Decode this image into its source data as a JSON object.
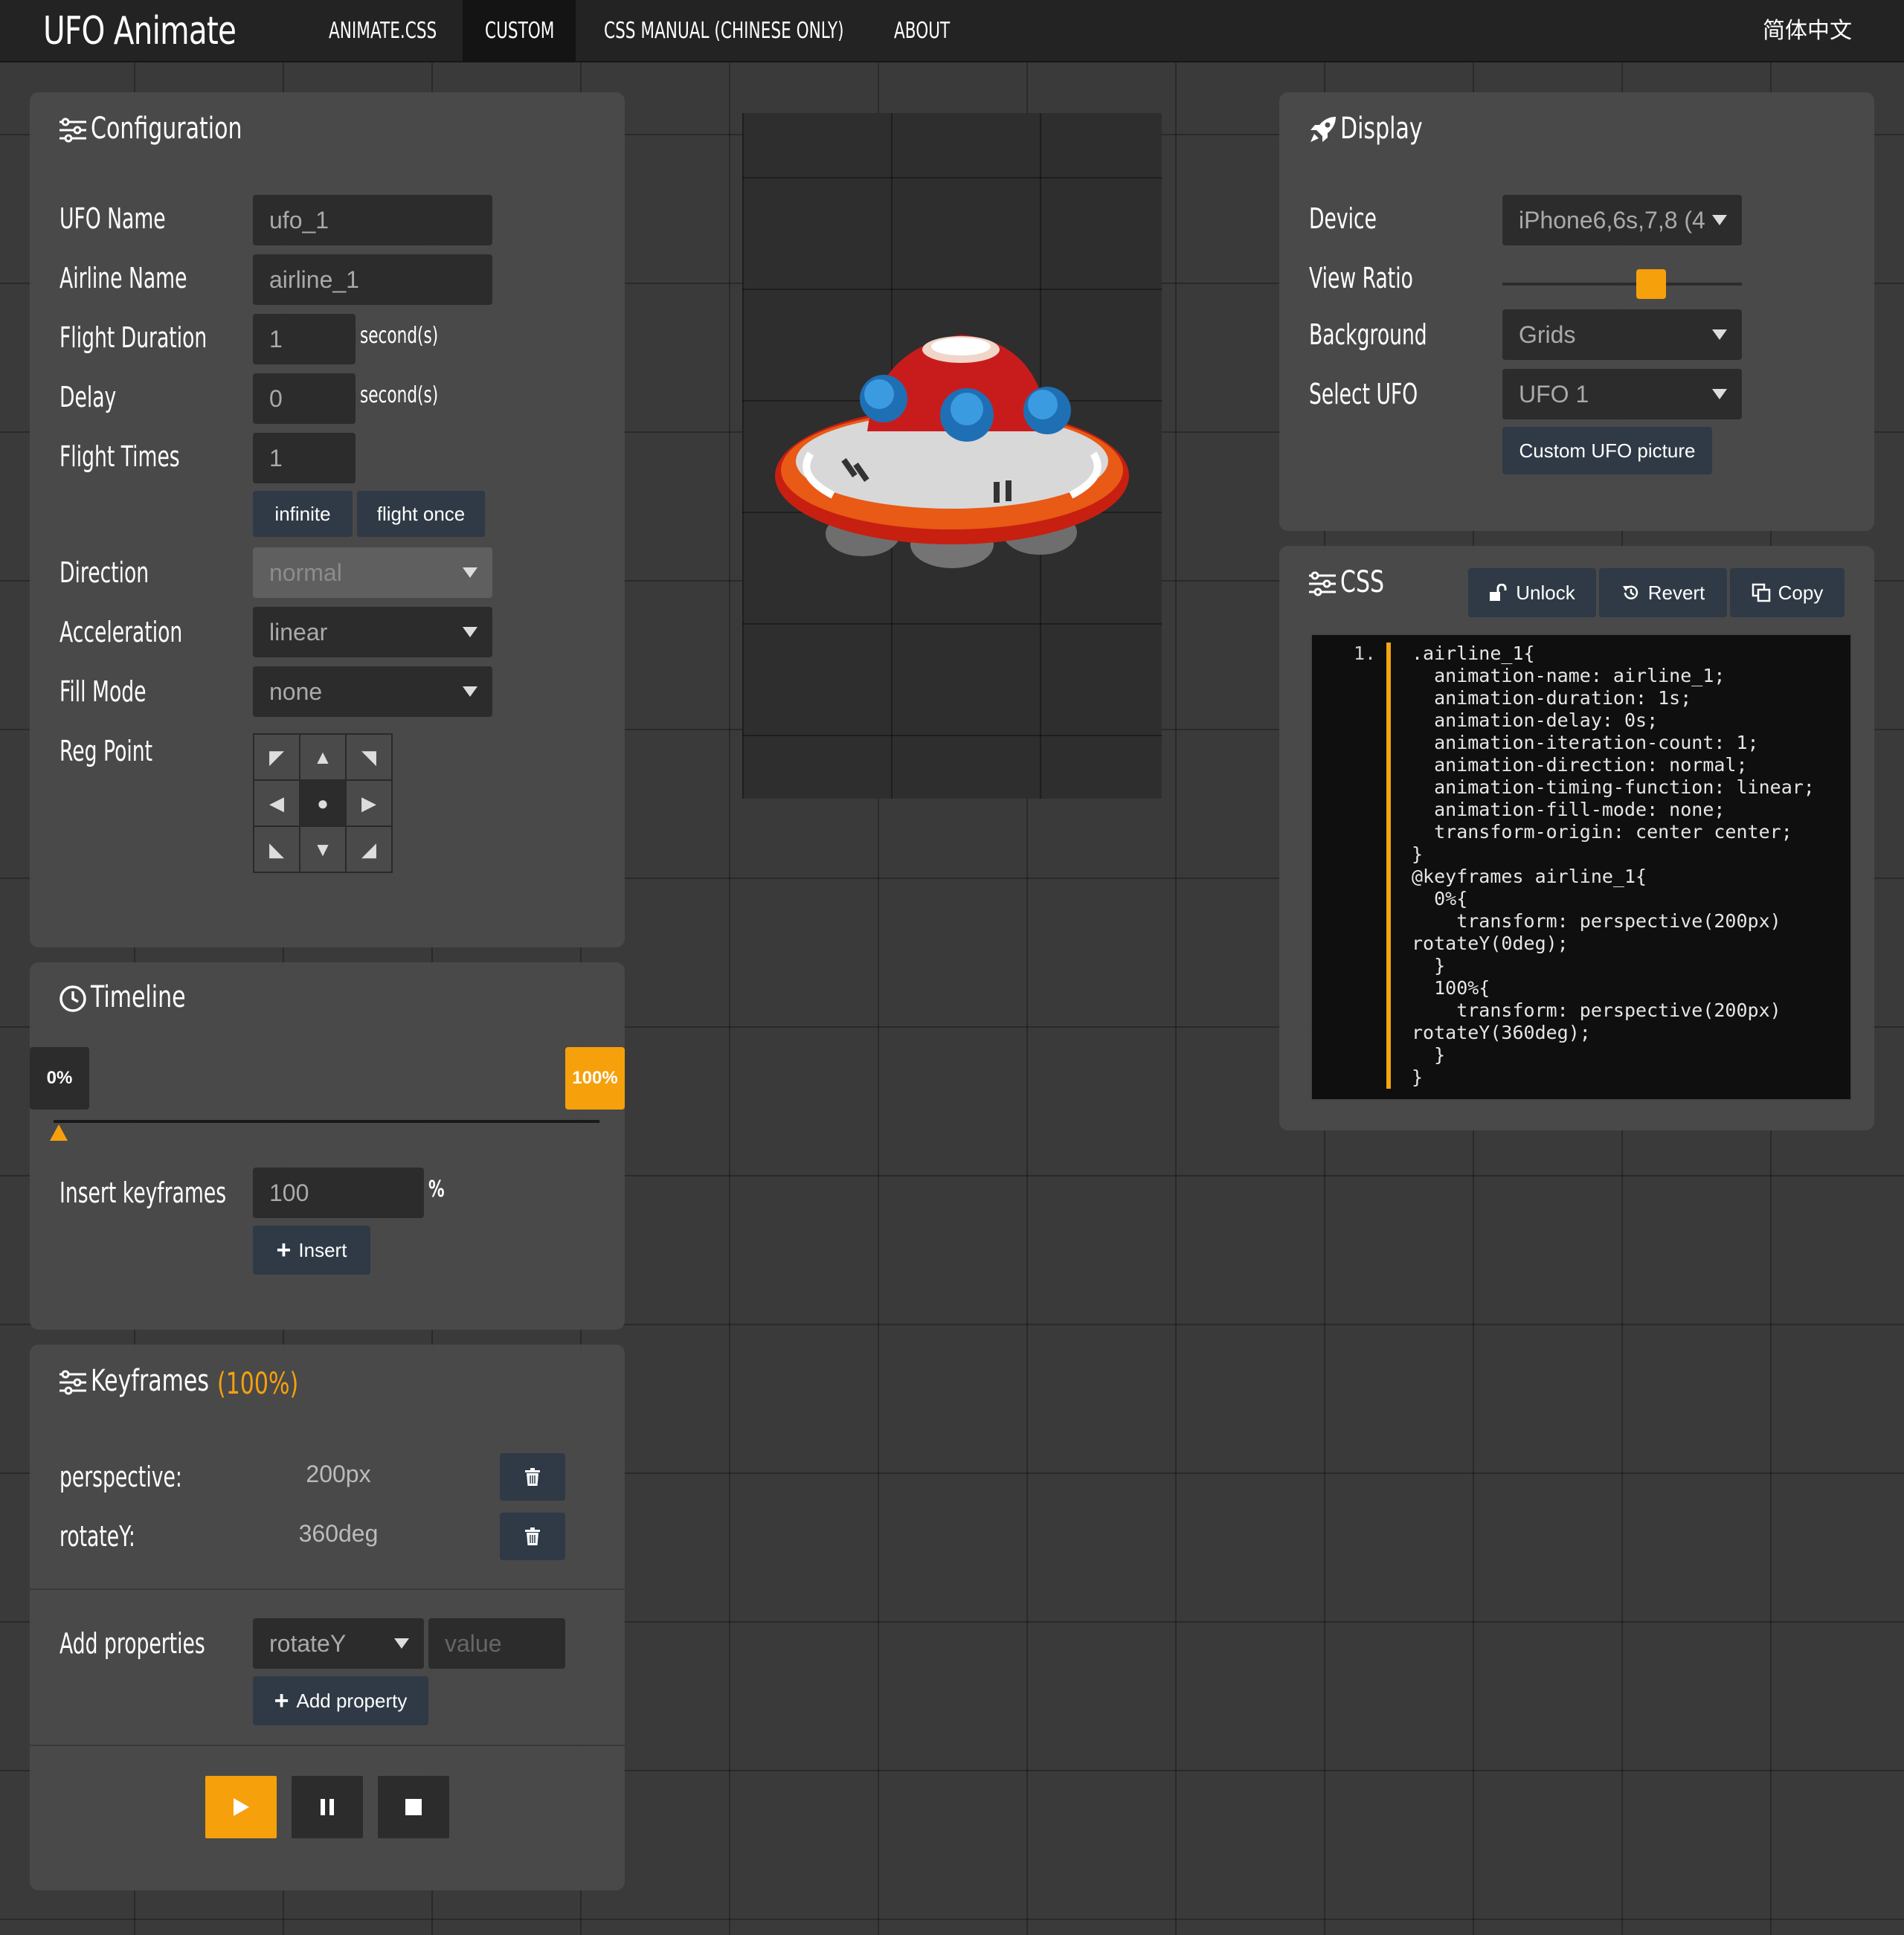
{
  "nav": {
    "brand": "UFO Animate",
    "items": [
      "ANIMATE.CSS",
      "CUSTOM",
      "CSS MANUAL (CHINESE ONLY)",
      "ABOUT"
    ],
    "active": "CUSTOM",
    "lang": "简体中文"
  },
  "config": {
    "title": "Configuration",
    "ufo_name_label": "UFO Name",
    "ufo_name": "ufo_1",
    "airline_name_label": "Airline Name",
    "airline_name": "airline_1",
    "duration_label": "Flight Duration",
    "duration": "1",
    "duration_unit": "second(s)",
    "delay_label": "Delay",
    "delay": "0",
    "delay_unit": "second(s)",
    "times_label": "Flight Times",
    "times": "1",
    "infinite_btn": "infinite",
    "once_btn": "flight once",
    "direction_label": "Direction",
    "direction": "normal",
    "accel_label": "Acceleration",
    "accel": "linear",
    "fill_label": "Fill Mode",
    "fill": "none",
    "reg_label": "Reg Point"
  },
  "timeline": {
    "title": "Timeline",
    "start_tag": "0%",
    "end_tag": "100%",
    "insert_label": "Insert keyframes",
    "insert_value": "100",
    "insert_unit": "%",
    "insert_btn": "Insert"
  },
  "keyframes": {
    "title": "Keyframes",
    "current": "(100%)",
    "props": [
      {
        "name": "perspective:",
        "value": "200px"
      },
      {
        "name": "rotateY:",
        "value": "360deg"
      }
    ],
    "add_label": "Add properties",
    "add_select": "rotateY",
    "add_placeholder": "value",
    "add_btn": "Add property"
  },
  "display": {
    "title": "Display",
    "device_label": "Device",
    "device": "iPhone6,6s,7,8 (4",
    "ratio_label": "View Ratio",
    "ratio": 0.64,
    "bg_label": "Background",
    "bg": "Grids",
    "ufo_label": "Select UFO",
    "ufo": "UFO 1",
    "custom_btn": "Custom UFO picture"
  },
  "css": {
    "title": "CSS",
    "unlock": "Unlock",
    "revert": "Revert",
    "copy": "Copy",
    "line_no": "1.",
    "code": ".airline_1{\n  animation-name: airline_1;\n  animation-duration: 1s;\n  animation-delay: 0s;\n  animation-iteration-count: 1;\n  animation-direction: normal;\n  animation-timing-function: linear;\n  animation-fill-mode: none;\n  transform-origin: center center;\n}\n@keyframes airline_1{\n  0%{\n    transform: perspective(200px)\nrotateY(0deg);\n  }\n  100%{\n    transform: perspective(200px)\nrotateY(360deg);\n  }\n}"
  },
  "colors": {
    "accent": "#f6a00c",
    "panel": "#4b4b4b",
    "button": "#2f3a46"
  }
}
